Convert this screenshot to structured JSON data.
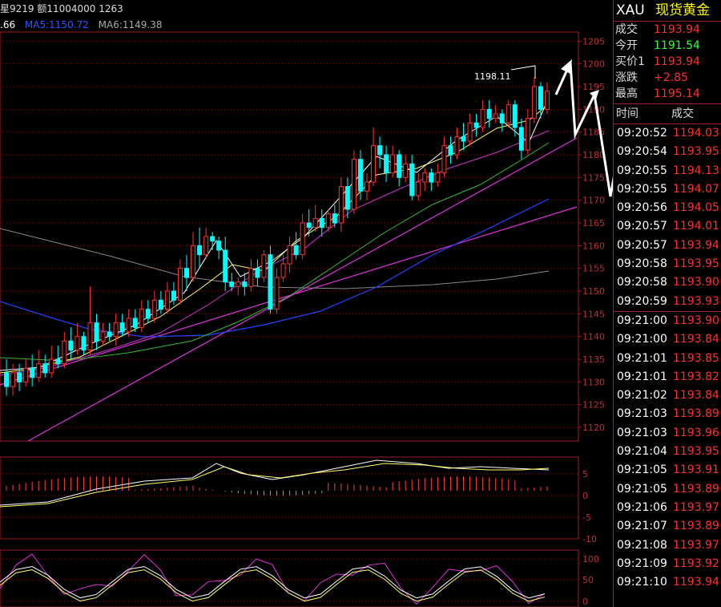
{
  "header": {
    "stat_text": "星9219 额11004000 1263",
    "ma_items": [
      {
        "label": ".66",
        "color": "#ffffff"
      },
      {
        "label": "MA5:1150.72",
        "color": "#3355ff"
      },
      {
        "label": "MA6:1149.38",
        "color": "#aaaaaa"
      }
    ]
  },
  "chart_data": [
    {
      "type": "candlestick",
      "y_ticks": [
        "1205",
        "1200",
        "1195",
        "1190",
        "1185",
        "1180",
        "1175",
        "1170",
        "1165",
        "1160",
        "1155",
        "1150",
        "1145",
        "1140",
        "1135",
        "1130",
        "1125",
        "1120"
      ],
      "ylim": [
        1117,
        1207
      ],
      "annotation": "1198.11",
      "candles": [
        [
          1132,
          1129,
          1135,
          1127
        ],
        [
          1129,
          1132,
          1134,
          1127
        ],
        [
          1132,
          1130,
          1134,
          1128
        ],
        [
          1130,
          1133,
          1135,
          1129
        ],
        [
          1133,
          1131,
          1136,
          1129
        ],
        [
          1131,
          1134,
          1137,
          1130
        ],
        [
          1134,
          1132,
          1136,
          1131
        ],
        [
          1132,
          1135,
          1138,
          1131
        ],
        [
          1135,
          1134,
          1138,
          1133
        ],
        [
          1134,
          1139,
          1141,
          1133
        ],
        [
          1139,
          1137,
          1142,
          1135
        ],
        [
          1137,
          1140,
          1143,
          1136
        ],
        [
          1140,
          1137,
          1141,
          1136
        ],
        [
          1137,
          1143,
          1151,
          1136
        ],
        [
          1143,
          1139,
          1145,
          1137
        ],
        [
          1139,
          1141,
          1143,
          1138
        ],
        [
          1141,
          1140,
          1143,
          1139
        ],
        [
          1140,
          1143,
          1145,
          1138
        ],
        [
          1143,
          1141,
          1145,
          1140
        ],
        [
          1141,
          1144,
          1146,
          1140
        ],
        [
          1144,
          1142,
          1146,
          1141
        ],
        [
          1142,
          1146,
          1148,
          1141
        ],
        [
          1146,
          1144,
          1148,
          1143
        ],
        [
          1144,
          1148,
          1150,
          1143
        ],
        [
          1148,
          1146,
          1150,
          1145
        ],
        [
          1146,
          1150,
          1152,
          1145
        ],
        [
          1150,
          1148,
          1152,
          1147
        ],
        [
          1148,
          1155,
          1157,
          1147
        ],
        [
          1155,
          1153,
          1158,
          1150
        ],
        [
          1153,
          1160,
          1163,
          1152
        ],
        [
          1160,
          1158,
          1164,
          1155
        ],
        [
          1158,
          1162,
          1164,
          1157
        ],
        [
          1162,
          1161,
          1163,
          1159
        ],
        [
          1161,
          1159,
          1162,
          1157
        ],
        [
          1159,
          1152,
          1162,
          1150
        ],
        [
          1152,
          1151,
          1154,
          1150
        ],
        [
          1151,
          1152,
          1153,
          1149
        ],
        [
          1152,
          1151,
          1154,
          1149
        ],
        [
          1151,
          1155,
          1157,
          1150
        ],
        [
          1155,
          1153,
          1157,
          1151
        ],
        [
          1153,
          1158,
          1159,
          1152
        ],
        [
          1158,
          1146,
          1160,
          1145
        ],
        [
          1146,
          1153,
          1155,
          1145
        ],
        [
          1153,
          1156,
          1158,
          1152
        ],
        [
          1156,
          1160,
          1162,
          1154
        ],
        [
          1160,
          1158,
          1163,
          1157
        ],
        [
          1158,
          1165,
          1167,
          1157
        ],
        [
          1165,
          1164,
          1168,
          1162
        ],
        [
          1164,
          1166,
          1169,
          1163
        ],
        [
          1166,
          1164,
          1168,
          1162
        ],
        [
          1164,
          1167,
          1168,
          1163
        ],
        [
          1167,
          1165,
          1169,
          1164
        ],
        [
          1165,
          1173,
          1175,
          1163
        ],
        [
          1173,
          1168,
          1175,
          1166
        ],
        [
          1168,
          1179,
          1181,
          1167
        ],
        [
          1179,
          1172,
          1181,
          1170
        ],
        [
          1172,
          1174,
          1176,
          1170
        ],
        [
          1174,
          1182,
          1186,
          1173
        ],
        [
          1182,
          1180,
          1184,
          1177
        ],
        [
          1180,
          1176,
          1182,
          1174
        ],
        [
          1176,
          1180,
          1182,
          1175
        ],
        [
          1180,
          1175,
          1181,
          1173
        ],
        [
          1175,
          1178,
          1180,
          1174
        ],
        [
          1178,
          1171,
          1180,
          1170
        ],
        [
          1171,
          1174,
          1176,
          1170
        ],
        [
          1174,
          1176,
          1177,
          1172
        ],
        [
          1176,
          1174,
          1177,
          1172
        ],
        [
          1174,
          1176,
          1178,
          1173
        ],
        [
          1176,
          1182,
          1184,
          1175
        ],
        [
          1182,
          1180,
          1184,
          1178
        ],
        [
          1180,
          1184,
          1186,
          1179
        ],
        [
          1184,
          1183,
          1187,
          1181
        ],
        [
          1183,
          1187,
          1189,
          1182
        ],
        [
          1187,
          1186,
          1189,
          1184
        ],
        [
          1186,
          1190,
          1192,
          1185
        ],
        [
          1190,
          1188,
          1192,
          1186
        ],
        [
          1188,
          1189,
          1191,
          1187
        ],
        [
          1189,
          1187,
          1190,
          1185
        ],
        [
          1187,
          1191,
          1192,
          1186
        ],
        [
          1191,
          1186,
          1192,
          1184
        ],
        [
          1186,
          1181,
          1188,
          1179
        ],
        [
          1181,
          1188,
          1190,
          1180
        ],
        [
          1188,
          1195,
          1197,
          1187
        ],
        [
          1195,
          1190,
          1196,
          1188
        ],
        [
          1190,
          1194,
          1196,
          1189
        ]
      ]
    }
  ],
  "ind1_ticks": [
    "5",
    "0",
    "-5",
    "-10"
  ],
  "ind2_ticks": [
    "100",
    "50",
    "0"
  ],
  "quote_panel": {
    "symbol": "XAU",
    "name": "现货黄金",
    "rows": [
      {
        "label": "成交",
        "value": "1193.94",
        "color": "#ff3030"
      },
      {
        "label": "今开",
        "value": "1191.54",
        "color": "#33ff33"
      },
      {
        "label": "买价1",
        "value": "1193.94",
        "color": "#ff3030"
      },
      {
        "label": "涨跌",
        "value": "+2.85",
        "color": "#ff3030"
      },
      {
        "label": "最高",
        "value": "1195.14",
        "color": "#ff3030"
      }
    ]
  },
  "ticks_panel": {
    "col_time": "时间",
    "col_price": "成交",
    "rows": [
      {
        "time": "09:20:52",
        "price": "1194.03"
      },
      {
        "time": "09:20:54",
        "price": "1193.95"
      },
      {
        "time": "09:20:55",
        "price": "1194.13"
      },
      {
        "time": "09:20:55",
        "price": "1194.07"
      },
      {
        "time": "09:20:56",
        "price": "1194.05"
      },
      {
        "time": "09:20:57",
        "price": "1194.01"
      },
      {
        "time": "09:20:57",
        "price": "1193.94"
      },
      {
        "time": "09:20:58",
        "price": "1193.95"
      },
      {
        "time": "09:20:58",
        "price": "1193.90"
      },
      {
        "time": "09:20:59",
        "price": "1193.93"
      },
      {
        "time": "09:21:00",
        "price": "1193.90"
      },
      {
        "time": "09:21:00",
        "price": "1193.84"
      },
      {
        "time": "09:21:01",
        "price": "1193.85"
      },
      {
        "time": "09:21:01",
        "price": "1193.82"
      },
      {
        "time": "09:21:02",
        "price": "1193.84"
      },
      {
        "time": "09:21:03",
        "price": "1193.89"
      },
      {
        "time": "09:21:03",
        "price": "1193.96"
      },
      {
        "time": "09:21:04",
        "price": "1193.95"
      },
      {
        "time": "09:21:05",
        "price": "1193.91"
      },
      {
        "time": "09:21:05",
        "price": "1193.89"
      },
      {
        "time": "09:21:06",
        "price": "1193.97"
      },
      {
        "time": "09:21:07",
        "price": "1193.89"
      },
      {
        "time": "09:21:08",
        "price": "1193.97"
      },
      {
        "time": "09:21:09",
        "price": "1193.92"
      },
      {
        "time": "09:21:10",
        "price": "1193.94"
      }
    ]
  }
}
